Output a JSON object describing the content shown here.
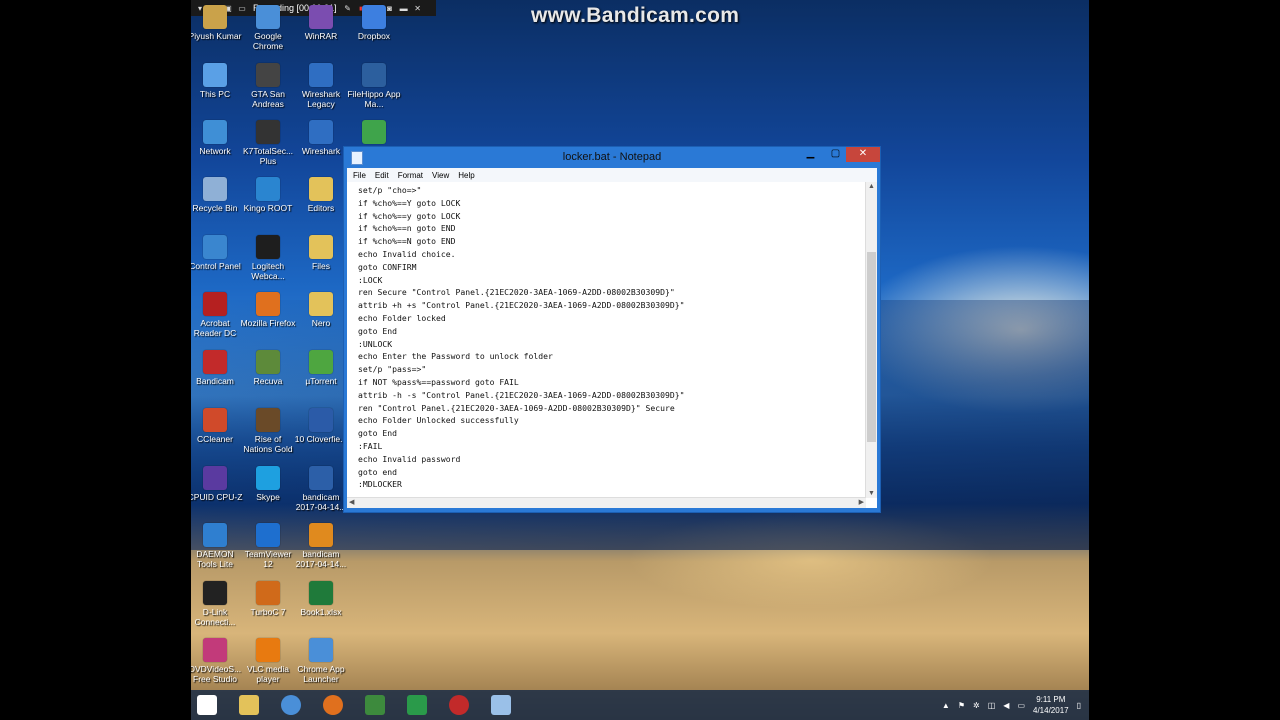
{
  "watermark": "www.Bandicam.com",
  "recording_bar": {
    "status": "Recording [00:00:21]"
  },
  "desktop_icons": [
    {
      "label": "Piyush Kumar",
      "color": "#caa24a"
    },
    {
      "label": "Google Chrome",
      "color": "#4a8fd8"
    },
    {
      "label": "WinRAR",
      "color": "#7b4db0"
    },
    {
      "label": "Dropbox",
      "color": "#3d7fe0"
    },
    {
      "label": "This PC",
      "color": "#5aa0e6"
    },
    {
      "label": "GTA San Andreas",
      "color": "#444444"
    },
    {
      "label": "Wireshark Legacy",
      "color": "#2f6ec2"
    },
    {
      "label": "FileHippo App Ma...",
      "color": "#2c5f9e"
    },
    {
      "label": "Network",
      "color": "#3f8fd6"
    },
    {
      "label": "K7TotalSec... Plus",
      "color": "#333333"
    },
    {
      "label": "Wireshark",
      "color": "#2f6ec2"
    },
    {
      "label": "",
      "color": "#3fa44b"
    },
    {
      "label": "Recycle Bin",
      "color": "#8fb0d6"
    },
    {
      "label": "Kingo ROOT",
      "color": "#2a85d0"
    },
    {
      "label": "Editors",
      "color": "#e3c25a"
    },
    {
      "label": "Control Panel",
      "color": "#3a86cf"
    },
    {
      "label": "Logitech Webca...",
      "color": "#1e1e1e"
    },
    {
      "label": "Files",
      "color": "#e3c25a"
    },
    {
      "label": "Acrobat Reader DC",
      "color": "#b52020"
    },
    {
      "label": "Mozilla Firefox",
      "color": "#e0701e"
    },
    {
      "label": "Nero",
      "color": "#e3c25a"
    },
    {
      "label": "Bandicam",
      "color": "#c22a2a"
    },
    {
      "label": "Recuva",
      "color": "#5d8a3a"
    },
    {
      "label": "µTorrent",
      "color": "#4ea640"
    },
    {
      "label": "CCleaner",
      "color": "#d04a2a"
    },
    {
      "label": "Rise of Nations Gold",
      "color": "#6a4a28"
    },
    {
      "label": "10 Cloverfie...",
      "color": "#2b5ba8"
    },
    {
      "label": "CPUID CPU-Z",
      "color": "#5a3aa0"
    },
    {
      "label": "Skype",
      "color": "#1ea0e0"
    },
    {
      "label": "bandicam 2017-04-14...",
      "color": "#2c5fa8"
    },
    {
      "label": "DAEMON Tools Lite",
      "color": "#2f7fd0"
    },
    {
      "label": "TeamViewer 12",
      "color": "#1e6fcf"
    },
    {
      "label": "bandicam 2017-04-14...",
      "color": "#e08a1e"
    },
    {
      "label": "D-Link Connecti...",
      "color": "#222222"
    },
    {
      "label": "TurboC 7",
      "color": "#d06a1a"
    },
    {
      "label": "Book1.xlsx",
      "color": "#1f7a3a"
    },
    {
      "label": "DVDVideoS... Free Studio",
      "color": "#c23a7a"
    },
    {
      "label": "VLC media player",
      "color": "#e87a10"
    },
    {
      "label": "Chrome App Launcher",
      "color": "#4a8fd8"
    }
  ],
  "notepad": {
    "title": "locker.bat - Notepad",
    "menu": [
      "File",
      "Edit",
      "Format",
      "View",
      "Help"
    ],
    "content": "set/p \"cho=>\"\nif %cho%==Y goto LOCK\nif %cho%==y goto LOCK\nif %cho%==n goto END\nif %cho%==N goto END\necho Invalid choice.\ngoto CONFIRM\n:LOCK\nren Secure \"Control Panel.{21EC2020-3AEA-1069-A2DD-08002B30309D}\"\nattrib +h +s \"Control Panel.{21EC2020-3AEA-1069-A2DD-08002B30309D}\"\necho Folder locked\ngoto End\n:UNLOCK\necho Enter the Password to unlock folder\nset/p \"pass=>\"\nif NOT %pass%==password goto FAIL\nattrib -h -s \"Control Panel.{21EC2020-3AEA-1069-A2DD-08002B30309D}\"\nren \"Control Panel.{21EC2020-3AEA-1069-A2DD-08002B30309D}\" Secure\necho Folder Unlocked successfully\ngoto End\n:FAIL\necho Invalid password\ngoto end\n:MDLOCKER"
  },
  "taskbar": {
    "apps": [
      {
        "name": "start-button",
        "color": "#ffffff"
      },
      {
        "name": "file-explorer",
        "color": "#e3c25a"
      },
      {
        "name": "chrome",
        "color": "#4a8fd8"
      },
      {
        "name": "firefox",
        "color": "#e0701e"
      },
      {
        "name": "app-launcher",
        "color": "#3d8a3d"
      },
      {
        "name": "store",
        "color": "#2a9a4a"
      },
      {
        "name": "bandicam",
        "color": "#c22a2a"
      },
      {
        "name": "notepad",
        "color": "#9ac0e8"
      }
    ],
    "time": "9:11 PM",
    "date": "4/14/2017"
  }
}
